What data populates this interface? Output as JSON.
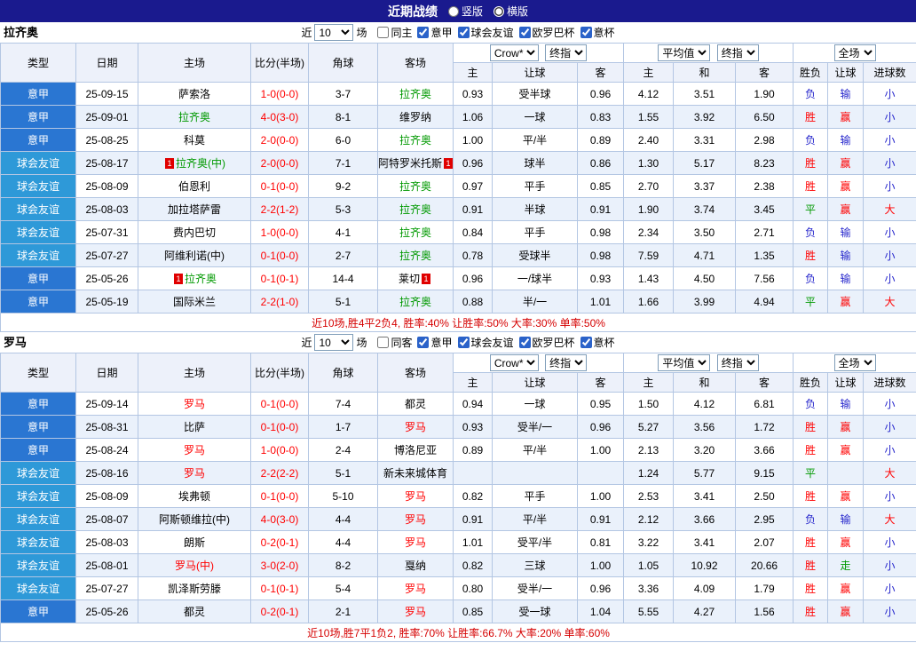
{
  "title_bar": {
    "title": "近期战绩",
    "vertical_label": "竖版",
    "horizontal_label": "横版"
  },
  "header": {
    "left_columns": [
      "类型",
      "日期",
      "主场",
      "比分(半场)",
      "角球",
      "客场"
    ],
    "odds_columns": [
      "主",
      "让球",
      "客",
      "主",
      "和",
      "客",
      "胜负",
      "让球",
      "进球数"
    ],
    "selects": {
      "company": "Crow*",
      "asian_final": "终指",
      "average": "平均值",
      "euro_final": "终指",
      "scope": "全场"
    }
  },
  "sections": [
    {
      "team": "拉齐奥",
      "filter": {
        "near_label": "近",
        "count": "10",
        "games_label": "场",
        "same_label": "同主",
        "leagues": [
          "意甲",
          "球会友谊",
          "欧罗巴杯",
          "意杯"
        ]
      },
      "rows": [
        {
          "type": "意甲",
          "type_kind": "league",
          "date": "25-09-15",
          "home": "萨索洛",
          "home_color": "",
          "home_card": "",
          "score": "1-0(0-0)",
          "corner": "3-7",
          "away": "拉齐奥",
          "away_color": "green",
          "away_card": "",
          "asian": [
            "0.93",
            "受半球",
            "0.96"
          ],
          "euro": [
            "4.12",
            "3.51",
            "1.90"
          ],
          "result": [
            "负",
            "输",
            "小"
          ]
        },
        {
          "type": "意甲",
          "type_kind": "league",
          "date": "25-09-01",
          "home": "拉齐奥",
          "home_color": "green",
          "home_card": "",
          "score": "4-0(3-0)",
          "corner": "8-1",
          "away": "维罗纳",
          "away_color": "",
          "away_card": "",
          "asian": [
            "1.06",
            "一球",
            "0.83"
          ],
          "euro": [
            "1.55",
            "3.92",
            "6.50"
          ],
          "result": [
            "胜",
            "赢",
            "小"
          ]
        },
        {
          "type": "意甲",
          "type_kind": "league",
          "date": "25-08-25",
          "home": "科莫",
          "home_color": "",
          "home_card": "",
          "score": "2-0(0-0)",
          "corner": "6-0",
          "away": "拉齐奥",
          "away_color": "green",
          "away_card": "",
          "asian": [
            "1.00",
            "平/半",
            "0.89"
          ],
          "euro": [
            "2.40",
            "3.31",
            "2.98"
          ],
          "result": [
            "负",
            "输",
            "小"
          ]
        },
        {
          "type": "球会友谊",
          "type_kind": "friendly",
          "date": "25-08-17",
          "home": "拉齐奥(中)",
          "home_color": "green",
          "home_card": "1",
          "score": "2-0(0-0)",
          "corner": "7-1",
          "away": "阿特罗米托斯",
          "away_color": "",
          "away_card": "1",
          "asian": [
            "0.96",
            "球半",
            "0.86"
          ],
          "euro": [
            "1.30",
            "5.17",
            "8.23"
          ],
          "result": [
            "胜",
            "赢",
            "小"
          ]
        },
        {
          "type": "球会友谊",
          "type_kind": "friendly",
          "date": "25-08-09",
          "home": "伯恩利",
          "home_color": "",
          "home_card": "",
          "score": "0-1(0-0)",
          "corner": "9-2",
          "away": "拉齐奥",
          "away_color": "green",
          "away_card": "",
          "asian": [
            "0.97",
            "平手",
            "0.85"
          ],
          "euro": [
            "2.70",
            "3.37",
            "2.38"
          ],
          "result": [
            "胜",
            "赢",
            "小"
          ]
        },
        {
          "type": "球会友谊",
          "type_kind": "friendly",
          "date": "25-08-03",
          "home": "加拉塔萨雷",
          "home_color": "",
          "home_card": "",
          "score": "2-2(1-2)",
          "corner": "5-3",
          "away": "拉齐奥",
          "away_color": "green",
          "away_card": "",
          "asian": [
            "0.91",
            "半球",
            "0.91"
          ],
          "euro": [
            "1.90",
            "3.74",
            "3.45"
          ],
          "result": [
            "平",
            "赢",
            "大"
          ]
        },
        {
          "type": "球会友谊",
          "type_kind": "friendly",
          "date": "25-07-31",
          "home": "费内巴切",
          "home_color": "",
          "home_card": "",
          "score": "1-0(0-0)",
          "corner": "4-1",
          "away": "拉齐奥",
          "away_color": "green",
          "away_card": "",
          "asian": [
            "0.84",
            "平手",
            "0.98"
          ],
          "euro": [
            "2.34",
            "3.50",
            "2.71"
          ],
          "result": [
            "负",
            "输",
            "小"
          ]
        },
        {
          "type": "球会友谊",
          "type_kind": "friendly",
          "date": "25-07-27",
          "home": "阿维利诺(中)",
          "home_color": "",
          "home_card": "",
          "score": "0-1(0-0)",
          "corner": "2-7",
          "away": "拉齐奥",
          "away_color": "green",
          "away_card": "",
          "asian": [
            "0.78",
            "受球半",
            "0.98"
          ],
          "euro": [
            "7.59",
            "4.71",
            "1.35"
          ],
          "result": [
            "胜",
            "输",
            "小"
          ]
        },
        {
          "type": "意甲",
          "type_kind": "league",
          "date": "25-05-26",
          "home": "拉齐奥",
          "home_color": "green",
          "home_card": "1",
          "score": "0-1(0-1)",
          "corner": "14-4",
          "away": "莱切",
          "away_color": "",
          "away_card": "1",
          "asian": [
            "0.96",
            "一/球半",
            "0.93"
          ],
          "euro": [
            "1.43",
            "4.50",
            "7.56"
          ],
          "result": [
            "负",
            "输",
            "小"
          ]
        },
        {
          "type": "意甲",
          "type_kind": "league",
          "date": "25-05-19",
          "home": "国际米兰",
          "home_color": "",
          "home_card": "",
          "score": "2-2(1-0)",
          "corner": "5-1",
          "away": "拉齐奥",
          "away_color": "green",
          "away_card": "",
          "asian": [
            "0.88",
            "半/一",
            "1.01"
          ],
          "euro": [
            "1.66",
            "3.99",
            "4.94"
          ],
          "result": [
            "平",
            "赢",
            "大"
          ]
        }
      ],
      "summary": "近10场,胜4平2负4, 胜率:40% 让胜率:50% 大率:30% 单率:50%"
    },
    {
      "team": "罗马",
      "filter": {
        "near_label": "近",
        "count": "10",
        "games_label": "场",
        "same_label": "同客",
        "leagues": [
          "意甲",
          "球会友谊",
          "欧罗巴杯",
          "意杯"
        ]
      },
      "rows": [
        {
          "type": "意甲",
          "type_kind": "league",
          "date": "25-09-14",
          "home": "罗马",
          "home_color": "red",
          "home_card": "",
          "score": "0-1(0-0)",
          "corner": "7-4",
          "away": "都灵",
          "away_color": "",
          "away_card": "",
          "asian": [
            "0.94",
            "一球",
            "0.95"
          ],
          "euro": [
            "1.50",
            "4.12",
            "6.81"
          ],
          "result": [
            "负",
            "输",
            "小"
          ]
        },
        {
          "type": "意甲",
          "type_kind": "league",
          "date": "25-08-31",
          "home": "比萨",
          "home_color": "",
          "home_card": "",
          "score": "0-1(0-0)",
          "corner": "1-7",
          "away": "罗马",
          "away_color": "red",
          "away_card": "",
          "asian": [
            "0.93",
            "受半/一",
            "0.96"
          ],
          "euro": [
            "5.27",
            "3.56",
            "1.72"
          ],
          "result": [
            "胜",
            "赢",
            "小"
          ]
        },
        {
          "type": "意甲",
          "type_kind": "league",
          "date": "25-08-24",
          "home": "罗马",
          "home_color": "red",
          "home_card": "",
          "score": "1-0(0-0)",
          "corner": "2-4",
          "away": "博洛尼亚",
          "away_color": "",
          "away_card": "",
          "asian": [
            "0.89",
            "平/半",
            "1.00"
          ],
          "euro": [
            "2.13",
            "3.20",
            "3.66"
          ],
          "result": [
            "胜",
            "赢",
            "小"
          ]
        },
        {
          "type": "球会友谊",
          "type_kind": "friendly",
          "date": "25-08-16",
          "home": "罗马",
          "home_color": "red",
          "home_card": "",
          "score": "2-2(2-2)",
          "corner": "5-1",
          "away": "新未来城体育",
          "away_color": "",
          "away_card": "",
          "asian": [
            "",
            "",
            ""
          ],
          "euro": [
            "1.24",
            "5.77",
            "9.15"
          ],
          "result": [
            "平",
            "",
            "大"
          ]
        },
        {
          "type": "球会友谊",
          "type_kind": "friendly",
          "date": "25-08-09",
          "home": "埃弗顿",
          "home_color": "",
          "home_card": "",
          "score": "0-1(0-0)",
          "corner": "5-10",
          "away": "罗马",
          "away_color": "red",
          "away_card": "",
          "asian": [
            "0.82",
            "平手",
            "1.00"
          ],
          "euro": [
            "2.53",
            "3.41",
            "2.50"
          ],
          "result": [
            "胜",
            "赢",
            "小"
          ]
        },
        {
          "type": "球会友谊",
          "type_kind": "friendly",
          "date": "25-08-07",
          "home": "阿斯顿维拉(中)",
          "home_color": "",
          "home_card": "",
          "score": "4-0(3-0)",
          "corner": "4-4",
          "away": "罗马",
          "away_color": "red",
          "away_card": "",
          "asian": [
            "0.91",
            "平/半",
            "0.91"
          ],
          "euro": [
            "2.12",
            "3.66",
            "2.95"
          ],
          "result": [
            "负",
            "输",
            "大"
          ]
        },
        {
          "type": "球会友谊",
          "type_kind": "friendly",
          "date": "25-08-03",
          "home": "朗斯",
          "home_color": "",
          "home_card": "",
          "score": "0-2(0-1)",
          "corner": "4-4",
          "away": "罗马",
          "away_color": "red",
          "away_card": "",
          "asian": [
            "1.01",
            "受平/半",
            "0.81"
          ],
          "euro": [
            "3.22",
            "3.41",
            "2.07"
          ],
          "result": [
            "胜",
            "赢",
            "小"
          ]
        },
        {
          "type": "球会友谊",
          "type_kind": "friendly",
          "date": "25-08-01",
          "home": "罗马(中)",
          "home_color": "red",
          "home_card": "",
          "score": "3-0(2-0)",
          "corner": "8-2",
          "away": "戛纳",
          "away_color": "",
          "away_card": "",
          "asian": [
            "0.82",
            "三球",
            "1.00"
          ],
          "euro": [
            "1.05",
            "10.92",
            "20.66"
          ],
          "result": [
            "胜",
            "走",
            "小"
          ]
        },
        {
          "type": "球会友谊",
          "type_kind": "friendly",
          "date": "25-07-27",
          "home": "凯泽斯劳滕",
          "home_color": "",
          "home_card": "",
          "score": "0-1(0-1)",
          "corner": "5-4",
          "away": "罗马",
          "away_color": "red",
          "away_card": "",
          "asian": [
            "0.80",
            "受半/一",
            "0.96"
          ],
          "euro": [
            "3.36",
            "4.09",
            "1.79"
          ],
          "result": [
            "胜",
            "赢",
            "小"
          ]
        },
        {
          "type": "意甲",
          "type_kind": "league",
          "date": "25-05-26",
          "home": "都灵",
          "home_color": "",
          "home_card": "",
          "score": "0-2(0-1)",
          "corner": "2-1",
          "away": "罗马",
          "away_color": "red",
          "away_card": "",
          "asian": [
            "0.85",
            "受一球",
            "1.04"
          ],
          "euro": [
            "5.55",
            "4.27",
            "1.56"
          ],
          "result": [
            "胜",
            "赢",
            "小"
          ]
        }
      ],
      "summary": "近10场,胜7平1负2, 胜率:70% 让胜率:66.7% 大率:20% 单率:60%"
    }
  ]
}
